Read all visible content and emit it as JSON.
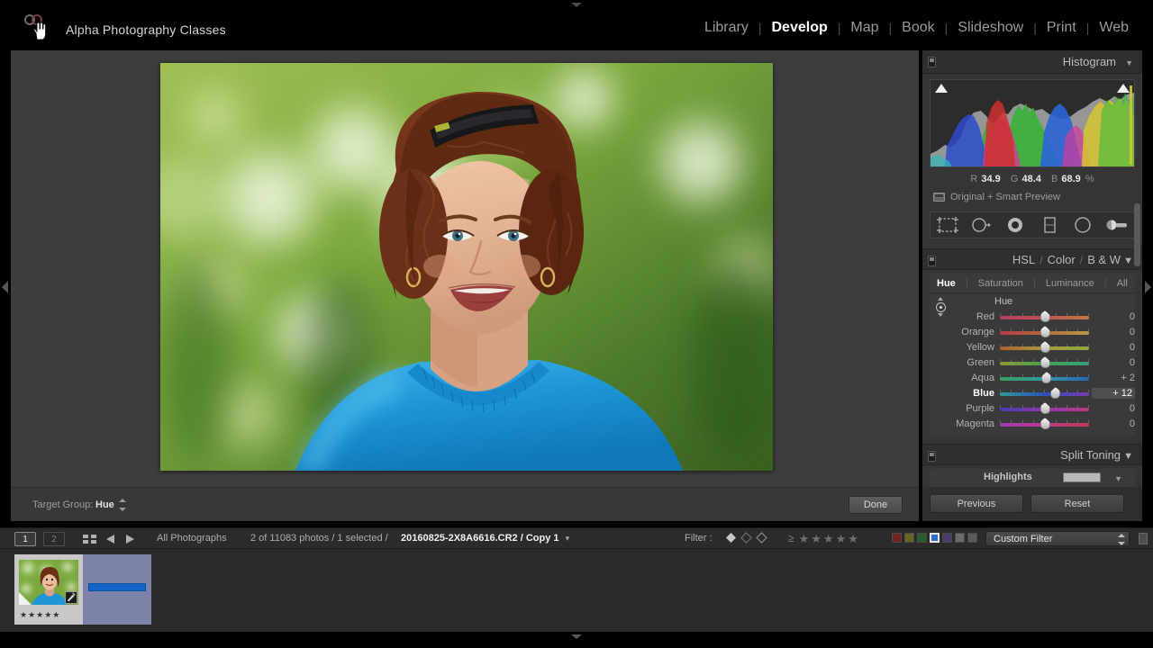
{
  "app": {
    "identity": "Alpha Photography Classes",
    "logo_icon": "lightroom-logo-icon",
    "cursor_icon": "hand-cursor-icon"
  },
  "modules": [
    {
      "label": "Library",
      "active": false
    },
    {
      "label": "Develop",
      "active": true
    },
    {
      "label": "Map",
      "active": false
    },
    {
      "label": "Book",
      "active": false
    },
    {
      "label": "Slideshow",
      "active": false
    },
    {
      "label": "Print",
      "active": false
    },
    {
      "label": "Web",
      "active": false
    }
  ],
  "histogram": {
    "title": "Histogram",
    "disclosure": "▼",
    "readout": {
      "r_label": "R",
      "r": "34.9",
      "g_label": "G",
      "g": "48.4",
      "b_label": "B",
      "b": "68.9",
      "unit": "%"
    },
    "preview_status": "Original + Smart Preview",
    "shadow_clip_icon": "shadow-clipping-triangle-icon",
    "highlight_clip_icon": "highlight-clipping-triangle-icon"
  },
  "tools": [
    {
      "name": "crop-overlay-tool",
      "title": "Crop Overlay"
    },
    {
      "name": "spot-removal-tool",
      "title": "Spot Removal"
    },
    {
      "name": "red-eye-correction-tool",
      "title": "Red Eye Correction"
    },
    {
      "name": "graduated-filter-tool",
      "title": "Graduated Filter"
    },
    {
      "name": "radial-filter-tool",
      "title": "Radial Filter"
    },
    {
      "name": "adjustment-brush-tool",
      "title": "Adjustment Brush"
    }
  ],
  "hsl": {
    "title_hsl": "HSL",
    "title_color": "Color",
    "title_bw": "B & W",
    "slash": "/",
    "disclosure": "▼",
    "tabs": [
      {
        "label": "Hue",
        "active": true
      },
      {
        "label": "Saturation",
        "active": false
      },
      {
        "label": "Luminance",
        "active": false
      },
      {
        "label": "All",
        "active": false
      }
    ],
    "sub_label": "Hue",
    "targeted_adjustment_icon": "targeted-adjustment-tool-icon",
    "sliders": [
      {
        "name": "Red",
        "value": "0",
        "pos": 50,
        "selected": false,
        "from": "#b2415c",
        "mid": "#c05050",
        "to": "#c07a40"
      },
      {
        "name": "Orange",
        "value": "0",
        "pos": 50,
        "selected": false,
        "from": "#b8384a",
        "mid": "#b06a3a",
        "to": "#b89a4a"
      },
      {
        "name": "Yellow",
        "value": "0",
        "pos": 50,
        "selected": false,
        "from": "#a8622c",
        "mid": "#a89a3c",
        "to": "#8ea83c"
      },
      {
        "name": "Green",
        "value": "0",
        "pos": 50,
        "selected": false,
        "from": "#8e9a34",
        "mid": "#46a04e",
        "to": "#34a07c"
      },
      {
        "name": "Aqua",
        "value": "+ 2",
        "pos": 52,
        "selected": false,
        "from": "#3aa05e",
        "mid": "#2e9aa0",
        "to": "#2e66b4"
      },
      {
        "name": "Blue",
        "value": "+ 12",
        "pos": 62,
        "selected": true,
        "from": "#2e9a9a",
        "mid": "#3050b8",
        "to": "#7a3ab0"
      },
      {
        "name": "Purple",
        "value": "0",
        "pos": 50,
        "selected": false,
        "from": "#4a3ab0",
        "mid": "#8a3ab0",
        "to": "#b83a7a"
      },
      {
        "name": "Magenta",
        "value": "0",
        "pos": 50,
        "selected": false,
        "from": "#a03ab0",
        "mid": "#bc3a8a",
        "to": "#bc3a54"
      }
    ]
  },
  "split_toning": {
    "title": "Split Toning",
    "disclosure": "▼",
    "highlights_label": "Highlights",
    "highlights_swatch": "#b9b9b9"
  },
  "toolbar": {
    "target_group_label": "Target Group:",
    "target_group_value": "Hue",
    "done_label": "Done"
  },
  "panel_buttons": {
    "previous_label": "Previous",
    "reset_label": "Reset"
  },
  "filmstrip_bar": {
    "screen1": "1",
    "screen2": "2",
    "grid_icon": "grid-view-icon",
    "back_icon": "go-back-arrow-icon",
    "forward_icon": "go-forward-arrow-icon",
    "source": "All Photographs",
    "count": "2 of 11083 photos / 1 selected /",
    "filename": "20160825-2X8A6616.CR2 / Copy 1",
    "filename_disclosure": "▾",
    "filter_label": "Filter :",
    "flags": [
      "flagged-pick-icon",
      "unflagged-icon",
      "rejected-icon"
    ],
    "rating_gte": "≥",
    "stars": 5,
    "color_labels": [
      {
        "name": "red-label",
        "color": "#6e2424",
        "selected": false
      },
      {
        "name": "yellow-label",
        "color": "#6a6424",
        "selected": false
      },
      {
        "name": "green-label",
        "color": "#2a5c2a",
        "selected": false
      },
      {
        "name": "blue-label",
        "color": "#2a6ed2",
        "selected": true
      },
      {
        "name": "purple-label",
        "color": "#4a3a6e",
        "selected": false
      },
      {
        "name": "gray-label",
        "color": "#6a6a6a",
        "selected": false
      },
      {
        "name": "none-label",
        "color": "#5a5a5a",
        "selected": false
      }
    ],
    "custom_filter": "Custom Filter"
  },
  "thumbnails": [
    {
      "name": "thumbnail-1",
      "rating": "★★★★★",
      "selected": true
    },
    {
      "name": "thumbnail-2",
      "rating": "",
      "selected": false
    }
  ]
}
